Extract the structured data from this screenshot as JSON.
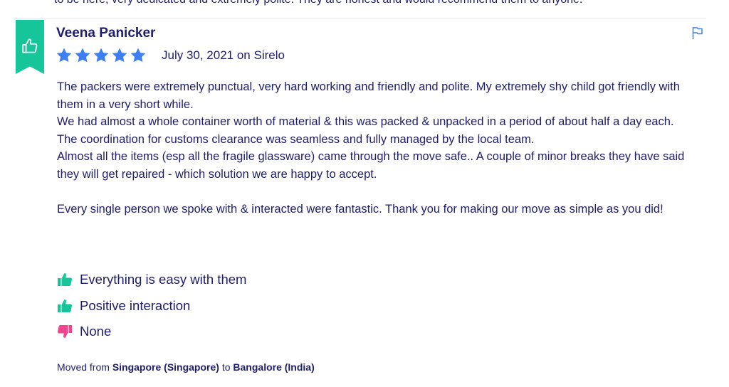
{
  "top_fragment": "to be here, very dedicated and extremely polite. They are honest and would recommend them to anyone.",
  "review": {
    "author": "Veena Panicker",
    "rating": 5,
    "rating_max": 5,
    "date_source": "July 30, 2021 on Sirelo",
    "paragraphs": [
      "The packers were extremely punctual, very hard working and friendly and polite. My extremely shy child got friendly with them in a very short while.",
      "We had almost a whole container worth of material & this was packed & unpacked in a period of about half a day each.",
      "The coordination for customs clearance was seamless and fully managed by the local team.",
      "Almost all the items (esp all the fragile glassware) came through the move safe.. A couple of minor breaks they have said they will get repaired - which solution we are happy to accept.",
      "",
      "Every single person we spoke with & interacted were fantastic. Thank you for making our move as simple as you did!"
    ],
    "pros": [
      "Everything is easy with them",
      "Positive interaction"
    ],
    "cons": [
      "None"
    ],
    "moved_prefix": "Moved from",
    "moved_from": "Singapore (Singapore)",
    "moved_connector": "to",
    "moved_to": "Bangalore (India)"
  },
  "colors": {
    "accent_green": "#17c59b",
    "accent_pink": "#f0448c",
    "star_blue": "#3d7ff3",
    "text_navy": "#1d1d6b"
  },
  "icons": {
    "ribbon": "thumbs-up-icon",
    "report": "flag-icon",
    "pro": "thumbs-up-icon",
    "con": "thumbs-down-icon",
    "rating": "star-icon"
  }
}
